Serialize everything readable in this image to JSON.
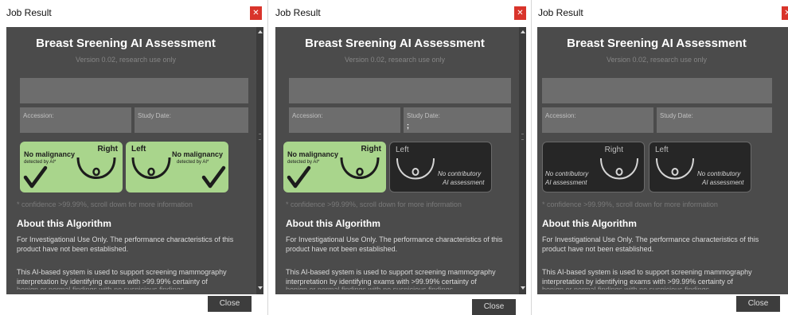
{
  "colors": {
    "panel_bg": "#4b4b4b",
    "field_bg": "#6d6d6d",
    "positive_card": "#a9d58c",
    "neutral_card": "#262626",
    "close_x": "#d9342b"
  },
  "windows": [
    {
      "title": "Job Result",
      "heading": "Breast Sreening AI Assessment",
      "version": "Version 0.02, research use only",
      "accession_label": "Accession:",
      "accession_value": "",
      "study_date_label": "Study Date:",
      "study_date_value": "",
      "right_card": {
        "state": "negative",
        "side": "Right",
        "line1": "No malignancy",
        "line2": "detected by AI*",
        "icon": "checkmark-icon"
      },
      "left_card": {
        "state": "negative",
        "side": "Left",
        "line1": "No malignancy",
        "line2": "detected by AI*",
        "icon": "checkmark-icon"
      },
      "confidence": "* confidence >99.99%, scroll down for more information",
      "about_title": "About this Algorithm",
      "about_p1": "For Investigational Use Only. The performance characteristics of this product have not been established.",
      "about_p2": "This AI-based system is used to support screening mammography interpretation by identifying exams with >99.99% certainty of",
      "about_p3": "benign or normal findings with no suspicious findings",
      "close_label": "Close"
    },
    {
      "title": "Job Result",
      "heading": "Breast Sreening AI Assessment",
      "version": "Version 0.02, research use only",
      "accession_label": "Accession:",
      "accession_value": "",
      "study_date_label": "Study Date:",
      "study_date_value": ";",
      "right_card": {
        "state": "negative",
        "side": "Right",
        "line1": "No malignancy",
        "line2": "detected by AI*",
        "icon": "checkmark-icon"
      },
      "left_card": {
        "state": "no-contribution",
        "side": "Left",
        "line1": "No contributory",
        "line2": "AI assessment"
      },
      "confidence": "* confidence >99.99%, scroll down for more information",
      "about_title": "About this Algorithm",
      "about_p1": "For Investigational Use Only. The performance characteristics of this product have not been established.",
      "about_p2": "This AI-based system is used to support screening mammography interpretation by identifying exams with >99.99% certainty of",
      "about_p3": "benign or normal findings with no suspicious findings",
      "close_label": "Close"
    },
    {
      "title": "Job Result",
      "heading": "Breast Sreening AI Assessment",
      "version": "Version 0.02, research use only",
      "accession_label": "Accession:",
      "accession_value": "",
      "study_date_label": "Study Date:",
      "study_date_value": "",
      "right_card": {
        "state": "no-contribution",
        "side": "Right",
        "line1": "No contributory",
        "line2": "AI assessment"
      },
      "left_card": {
        "state": "no-contribution",
        "side": "Left",
        "line1": "No contributory",
        "line2": "AI assessment"
      },
      "confidence": "* confidence >99.99%, scroll down for more information",
      "about_title": "About this Algorithm",
      "about_p1": "For Investigational Use Only. The performance characteristics of this product have not been established.",
      "about_p2": "This AI-based system is used to support screening mammography interpretation by identifying exams with >99.99% certainty of",
      "about_p3": "benign or normal findings with no suspicious findings",
      "close_label": "Close"
    }
  ]
}
